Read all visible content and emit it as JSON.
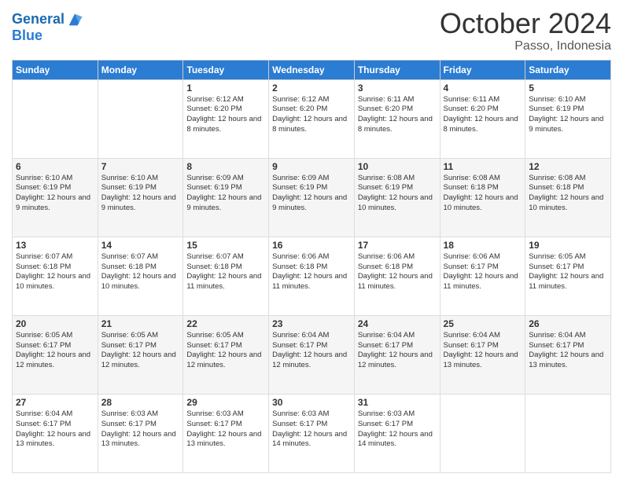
{
  "header": {
    "logo_line1": "General",
    "logo_line2": "Blue",
    "month": "October 2024",
    "location": "Passo, Indonesia"
  },
  "days_of_week": [
    "Sunday",
    "Monday",
    "Tuesday",
    "Wednesday",
    "Thursday",
    "Friday",
    "Saturday"
  ],
  "weeks": [
    [
      {
        "day": "",
        "info": ""
      },
      {
        "day": "",
        "info": ""
      },
      {
        "day": "1",
        "info": "Sunrise: 6:12 AM\nSunset: 6:20 PM\nDaylight: 12 hours and 8 minutes."
      },
      {
        "day": "2",
        "info": "Sunrise: 6:12 AM\nSunset: 6:20 PM\nDaylight: 12 hours and 8 minutes."
      },
      {
        "day": "3",
        "info": "Sunrise: 6:11 AM\nSunset: 6:20 PM\nDaylight: 12 hours and 8 minutes."
      },
      {
        "day": "4",
        "info": "Sunrise: 6:11 AM\nSunset: 6:20 PM\nDaylight: 12 hours and 8 minutes."
      },
      {
        "day": "5",
        "info": "Sunrise: 6:10 AM\nSunset: 6:19 PM\nDaylight: 12 hours and 9 minutes."
      }
    ],
    [
      {
        "day": "6",
        "info": "Sunrise: 6:10 AM\nSunset: 6:19 PM\nDaylight: 12 hours and 9 minutes."
      },
      {
        "day": "7",
        "info": "Sunrise: 6:10 AM\nSunset: 6:19 PM\nDaylight: 12 hours and 9 minutes."
      },
      {
        "day": "8",
        "info": "Sunrise: 6:09 AM\nSunset: 6:19 PM\nDaylight: 12 hours and 9 minutes."
      },
      {
        "day": "9",
        "info": "Sunrise: 6:09 AM\nSunset: 6:19 PM\nDaylight: 12 hours and 9 minutes."
      },
      {
        "day": "10",
        "info": "Sunrise: 6:08 AM\nSunset: 6:19 PM\nDaylight: 12 hours and 10 minutes."
      },
      {
        "day": "11",
        "info": "Sunrise: 6:08 AM\nSunset: 6:18 PM\nDaylight: 12 hours and 10 minutes."
      },
      {
        "day": "12",
        "info": "Sunrise: 6:08 AM\nSunset: 6:18 PM\nDaylight: 12 hours and 10 minutes."
      }
    ],
    [
      {
        "day": "13",
        "info": "Sunrise: 6:07 AM\nSunset: 6:18 PM\nDaylight: 12 hours and 10 minutes."
      },
      {
        "day": "14",
        "info": "Sunrise: 6:07 AM\nSunset: 6:18 PM\nDaylight: 12 hours and 10 minutes."
      },
      {
        "day": "15",
        "info": "Sunrise: 6:07 AM\nSunset: 6:18 PM\nDaylight: 12 hours and 11 minutes."
      },
      {
        "day": "16",
        "info": "Sunrise: 6:06 AM\nSunset: 6:18 PM\nDaylight: 12 hours and 11 minutes."
      },
      {
        "day": "17",
        "info": "Sunrise: 6:06 AM\nSunset: 6:18 PM\nDaylight: 12 hours and 11 minutes."
      },
      {
        "day": "18",
        "info": "Sunrise: 6:06 AM\nSunset: 6:17 PM\nDaylight: 12 hours and 11 minutes."
      },
      {
        "day": "19",
        "info": "Sunrise: 6:05 AM\nSunset: 6:17 PM\nDaylight: 12 hours and 11 minutes."
      }
    ],
    [
      {
        "day": "20",
        "info": "Sunrise: 6:05 AM\nSunset: 6:17 PM\nDaylight: 12 hours and 12 minutes."
      },
      {
        "day": "21",
        "info": "Sunrise: 6:05 AM\nSunset: 6:17 PM\nDaylight: 12 hours and 12 minutes."
      },
      {
        "day": "22",
        "info": "Sunrise: 6:05 AM\nSunset: 6:17 PM\nDaylight: 12 hours and 12 minutes."
      },
      {
        "day": "23",
        "info": "Sunrise: 6:04 AM\nSunset: 6:17 PM\nDaylight: 12 hours and 12 minutes."
      },
      {
        "day": "24",
        "info": "Sunrise: 6:04 AM\nSunset: 6:17 PM\nDaylight: 12 hours and 12 minutes."
      },
      {
        "day": "25",
        "info": "Sunrise: 6:04 AM\nSunset: 6:17 PM\nDaylight: 12 hours and 13 minutes."
      },
      {
        "day": "26",
        "info": "Sunrise: 6:04 AM\nSunset: 6:17 PM\nDaylight: 12 hours and 13 minutes."
      }
    ],
    [
      {
        "day": "27",
        "info": "Sunrise: 6:04 AM\nSunset: 6:17 PM\nDaylight: 12 hours and 13 minutes."
      },
      {
        "day": "28",
        "info": "Sunrise: 6:03 AM\nSunset: 6:17 PM\nDaylight: 12 hours and 13 minutes."
      },
      {
        "day": "29",
        "info": "Sunrise: 6:03 AM\nSunset: 6:17 PM\nDaylight: 12 hours and 13 minutes."
      },
      {
        "day": "30",
        "info": "Sunrise: 6:03 AM\nSunset: 6:17 PM\nDaylight: 12 hours and 14 minutes."
      },
      {
        "day": "31",
        "info": "Sunrise: 6:03 AM\nSunset: 6:17 PM\nDaylight: 12 hours and 14 minutes."
      },
      {
        "day": "",
        "info": ""
      },
      {
        "day": "",
        "info": ""
      }
    ]
  ]
}
